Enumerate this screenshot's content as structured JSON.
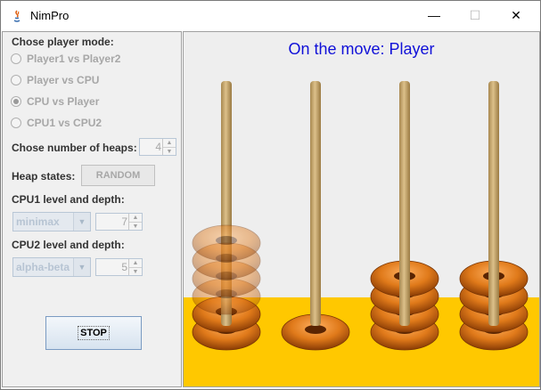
{
  "window": {
    "title": "NimPro",
    "min_glyph": "—",
    "max_glyph": "☐",
    "close_glyph": "✕"
  },
  "settings": {
    "player_mode_label": "Chose player mode:",
    "modes": [
      {
        "label": "Player1 vs Player2",
        "checked": false
      },
      {
        "label": "Player vs CPU",
        "checked": false
      },
      {
        "label": "CPU vs Player",
        "checked": true
      },
      {
        "label": "CPU1 vs CPU2",
        "checked": false
      }
    ],
    "heaps_label": "Chose number of heaps:",
    "heaps_value": "4",
    "heap_states_label": "Heap states:",
    "random_button": "RANDOM",
    "cpu1_label": "CPU1 level and depth:",
    "cpu1_algorithm": "minimax",
    "cpu1_depth": "7",
    "cpu2_label": "CPU2 level and depth:",
    "cpu2_algorithm": "alpha-beta",
    "cpu2_depth": "5",
    "stop_button": "STOP"
  },
  "board": {
    "status": "On the move: Player",
    "heaps": [
      {
        "tokens": 2,
        "ghost_tokens": 4
      },
      {
        "tokens": 1,
        "ghost_tokens": 0
      },
      {
        "tokens": 4,
        "ghost_tokens": 0
      },
      {
        "tokens": 4,
        "ghost_tokens": 0
      }
    ],
    "colors": {
      "floor": "#ffc800",
      "donut": "#e07a1a",
      "peg": "#c9a86a",
      "status_text": "#1010d8"
    }
  }
}
